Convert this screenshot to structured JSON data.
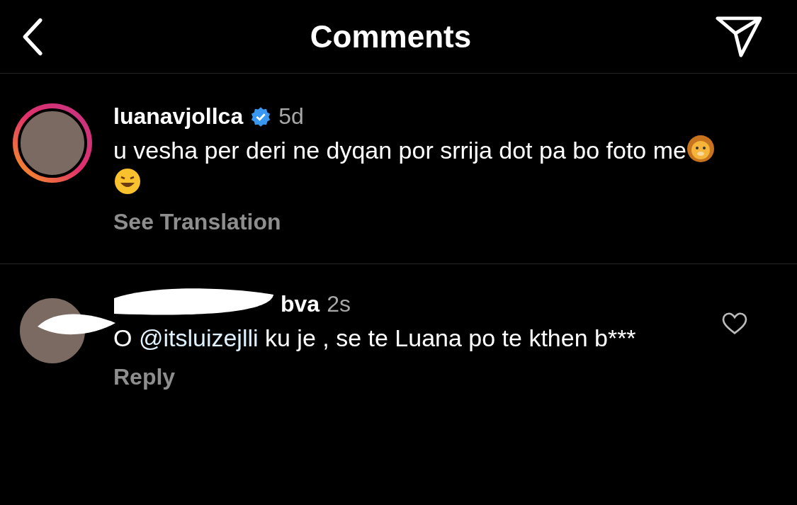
{
  "header": {
    "title": "Comments"
  },
  "comments": [
    {
      "username": "luanavjollca",
      "verified": true,
      "time": "5d",
      "redacted": false,
      "story_ring": true,
      "text_parts": [
        {
          "kind": "text",
          "text": "u vesha per deri ne dyqan por srrija dot pa bo foto me"
        }
      ],
      "emojis": true,
      "action": "See Translation"
    },
    {
      "username": "bva",
      "verified": false,
      "time": "2s",
      "redacted": true,
      "story_ring": false,
      "text_parts": [
        {
          "kind": "text",
          "text": "O "
        },
        {
          "kind": "mention",
          "text": "@itsluizejlli"
        },
        {
          "kind": "text",
          "text": "  ku je , se te Luana po te kthen b***"
        }
      ],
      "emojis": false,
      "liked": false,
      "action": "Reply"
    }
  ]
}
